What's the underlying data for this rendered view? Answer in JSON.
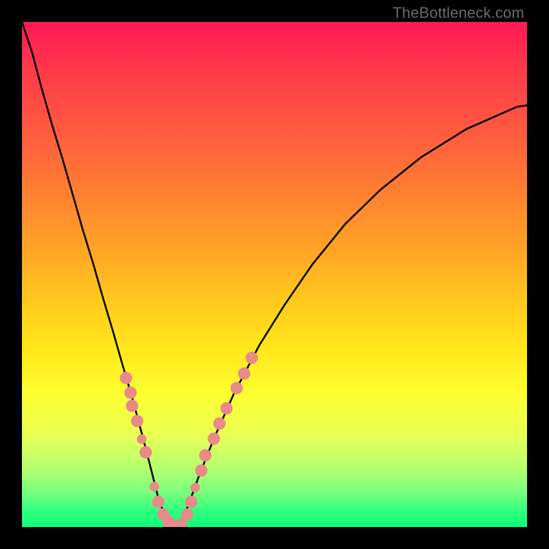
{
  "watermark": "TheBottleneck.com",
  "chart_data": {
    "type": "line",
    "title": "",
    "xlabel": "",
    "ylabel": "",
    "xlim": [
      0,
      1
    ],
    "ylim": [
      0,
      1
    ],
    "series": [
      {
        "name": "curve",
        "x": [
          0.0,
          0.02,
          0.04,
          0.06,
          0.08,
          0.1,
          0.12,
          0.14,
          0.16,
          0.18,
          0.2,
          0.22,
          0.24,
          0.258,
          0.268,
          0.278,
          0.288,
          0.296,
          0.304,
          0.31,
          0.318,
          0.33,
          0.35,
          0.38,
          0.42,
          0.47,
          0.52,
          0.575,
          0.64,
          0.71,
          0.79,
          0.88,
          0.98,
          1.0
        ],
        "y": [
          1.0,
          0.94,
          0.865,
          0.795,
          0.73,
          0.66,
          0.59,
          0.525,
          0.455,
          0.388,
          0.318,
          0.25,
          0.175,
          0.105,
          0.065,
          0.035,
          0.015,
          0.005,
          0.0,
          0.005,
          0.015,
          0.045,
          0.1,
          0.175,
          0.265,
          0.36,
          0.44,
          0.52,
          0.6,
          0.668,
          0.732,
          0.788,
          0.832,
          0.835
        ]
      }
    ],
    "markers": {
      "color": "#e78a88",
      "radius_main": 9,
      "radius_small": 7,
      "points": [
        {
          "x": 0.206,
          "y": 0.295
        },
        {
          "x": 0.215,
          "y": 0.266
        },
        {
          "x": 0.218,
          "y": 0.24
        },
        {
          "x": 0.228,
          "y": 0.21
        },
        {
          "x": 0.237,
          "y": 0.174,
          "small": true
        },
        {
          "x": 0.245,
          "y": 0.148
        },
        {
          "x": 0.262,
          "y": 0.08,
          "small": true
        },
        {
          "x": 0.27,
          "y": 0.05
        },
        {
          "x": 0.28,
          "y": 0.025
        },
        {
          "x": 0.29,
          "y": 0.01
        },
        {
          "x": 0.302,
          "y": 0.002
        },
        {
          "x": 0.315,
          "y": 0.005
        },
        {
          "x": 0.327,
          "y": 0.025
        },
        {
          "x": 0.335,
          "y": 0.05
        },
        {
          "x": 0.343,
          "y": 0.078,
          "small": true
        },
        {
          "x": 0.355,
          "y": 0.112
        },
        {
          "x": 0.363,
          "y": 0.142
        },
        {
          "x": 0.38,
          "y": 0.175
        },
        {
          "x": 0.391,
          "y": 0.205
        },
        {
          "x": 0.405,
          "y": 0.235
        },
        {
          "x": 0.425,
          "y": 0.275
        },
        {
          "x": 0.44,
          "y": 0.304
        },
        {
          "x": 0.455,
          "y": 0.335
        }
      ]
    }
  }
}
